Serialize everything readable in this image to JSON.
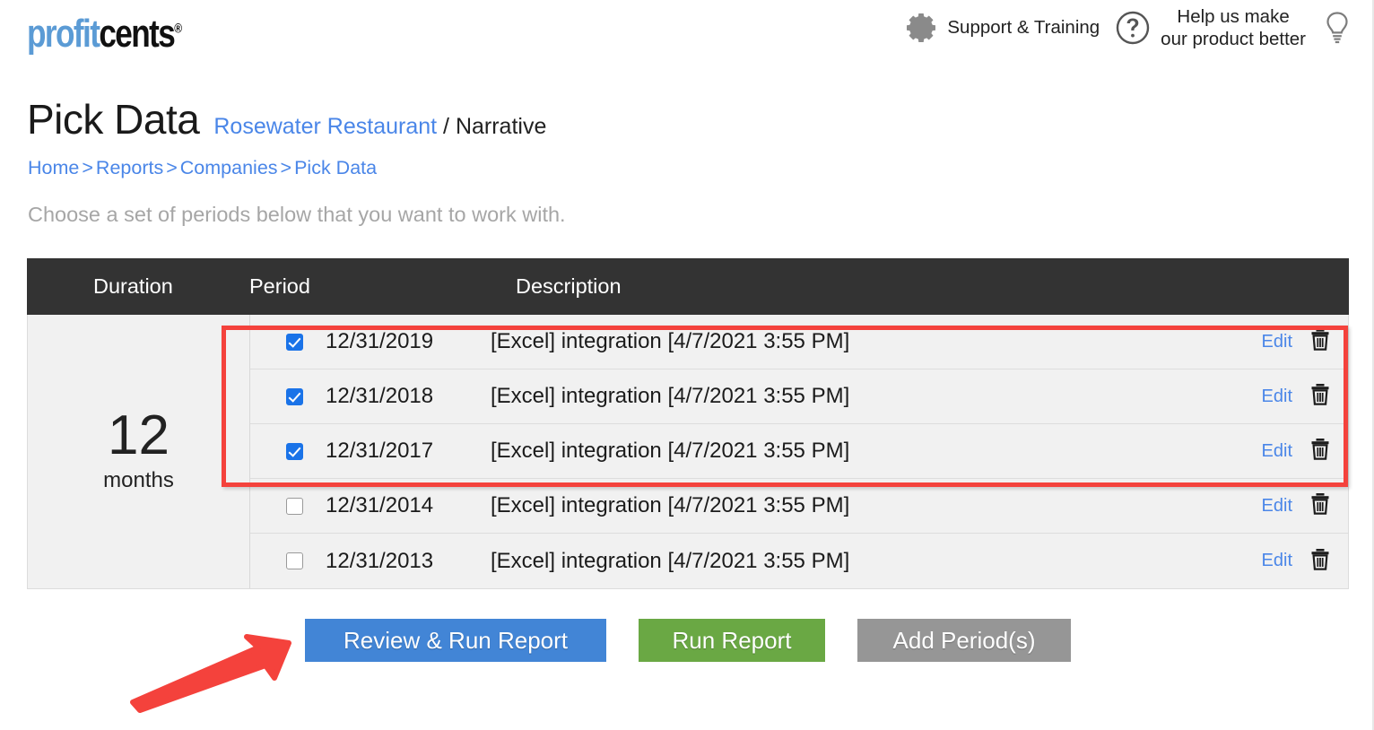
{
  "app": {
    "logo_profit": "profit",
    "logo_cents": "cents",
    "logo_tm": "®"
  },
  "header": {
    "gear_icon": "gear-icon",
    "support_label": "Support & Training",
    "help_icon": "question-circle-icon",
    "feedback_line1": "Help us make",
    "feedback_line2": "our product better",
    "lightbulb_icon": "lightbulb-icon"
  },
  "page": {
    "title": "Pick Data",
    "company_link": "Rosewater Restaurant",
    "report_type": "/ Narrative",
    "instruction": "Choose a set of periods below that you want to work with."
  },
  "breadcrumb": {
    "items": [
      {
        "label": "Home"
      },
      {
        "label": "Reports"
      },
      {
        "label": "Companies"
      },
      {
        "label": "Pick Data"
      }
    ],
    "separator": ">"
  },
  "table": {
    "headers": {
      "duration": "Duration",
      "period": "Period",
      "description": "Description"
    },
    "duration_value": "12",
    "duration_unit": "months",
    "edit_label": "Edit",
    "delete_icon": "trash-icon",
    "rows": [
      {
        "checked": true,
        "period": "12/31/2019",
        "description": "[Excel] integration [4/7/2021 3:55 PM]",
        "edit": "Edit"
      },
      {
        "checked": true,
        "period": "12/31/2018",
        "description": "[Excel] integration [4/7/2021 3:55 PM]",
        "edit": "Edit"
      },
      {
        "checked": true,
        "period": "12/31/2017",
        "description": "[Excel] integration [4/7/2021 3:55 PM]",
        "edit": "Edit"
      },
      {
        "checked": false,
        "period": "12/31/2014",
        "description": "[Excel] integration [4/7/2021 3:55 PM]",
        "edit": "Edit"
      },
      {
        "checked": false,
        "period": "12/31/2013",
        "description": "[Excel] integration [4/7/2021 3:55 PM]",
        "edit": "Edit"
      }
    ]
  },
  "buttons": {
    "review_run": "Review & Run Report",
    "run": "Run Report",
    "add_period": "Add Period(s)"
  },
  "annotations": {
    "highlight_box_color": "#f4423c",
    "arrow_color": "#f4423c"
  },
  "colors": {
    "logo_blue": "#5b9bd5",
    "link_blue": "#4a86e8",
    "table_header_bg": "#333333",
    "row_bg": "#f1f1f1",
    "checkbox_blue": "#1a73e8",
    "btn_review_blue": "#4285d6",
    "btn_run_green": "#6aa844",
    "btn_add_gray": "#969696"
  }
}
